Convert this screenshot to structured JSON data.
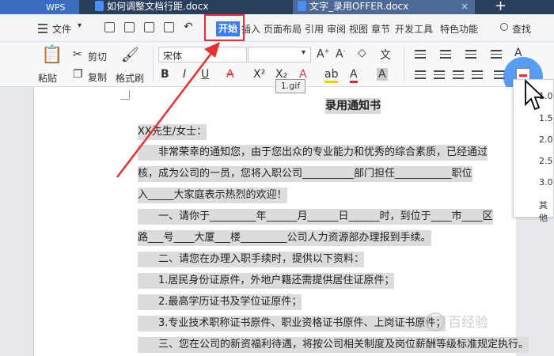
{
  "tabbar": {
    "app_label": "WPS",
    "tab1_label": "如何调整文档行距.docx",
    "tab2_label": "文字_录用OFFER.docx",
    "close_glyph": "×",
    "add_glyph": "+"
  },
  "menubar": {
    "file_label": "文件",
    "items": [
      "开始",
      "插入",
      "页面布局",
      "引用",
      "审阅",
      "视图",
      "章节",
      "开发工具",
      "特色功能"
    ],
    "search_label": "查找"
  },
  "ribbon": {
    "paste_label": "粘贴",
    "cut_label": "剪切",
    "copy_label": "复制",
    "format_painter_label": "格式刷",
    "font_name": "宋体",
    "tooltip": "1.gif"
  },
  "document": {
    "title": "录用通知书",
    "lines": [
      "XX先生/女士：",
      "非常荣幸的通知您，由于您出众的专业能力和优秀的综合素质，已经通过",
      "核，成为公司的一员，您将入职公司__________部门担任___________职位",
      "入_____大家庭表示热烈的欢迎！",
      "一、请你于_________年______月______日______时，到位于____市____区",
      "路___号____大厦___楼_________公司人力资源部办理报到手续。",
      "二、请您在办理入职手续时，提供以下资料：",
      "1.居民身份证原件，外地户籍还需提供居住证原件；",
      "2.最高学历证书及学位证原件；",
      "3.专业技术职称证书原件、职业资格证书原件、上岗证书原件；",
      "三、您在公司的新资福利待遇，将按公司相关制度及岗位薪酬等级标准规定执行。"
    ]
  },
  "line_spacing_menu": {
    "options": [
      "1.0",
      "1.5",
      "2.0",
      "2.5",
      "3.0",
      "其他"
    ]
  },
  "watermark": "百经验",
  "colors": {
    "accent": "#3c7ff0",
    "annotation_red": "#e83030",
    "tabbar_bg": "#2a3e5e"
  }
}
